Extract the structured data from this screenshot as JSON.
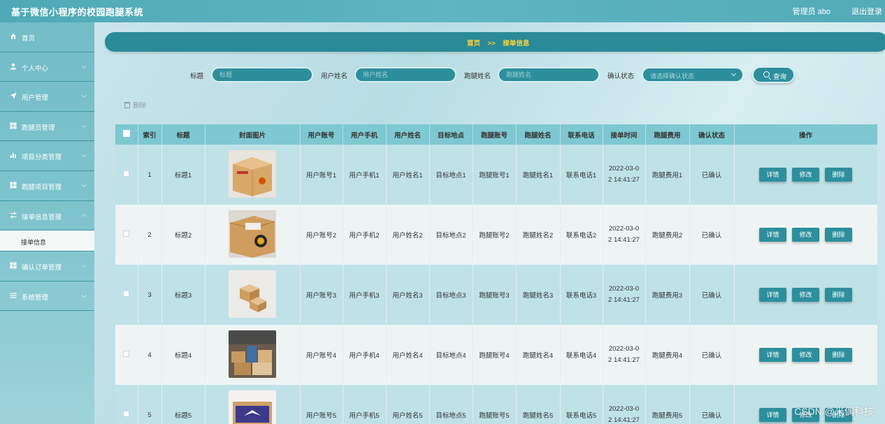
{
  "header": {
    "title": "基于微信小程序的校园跑腿系统",
    "admin": "管理员 abo",
    "logout": "退出登录"
  },
  "sidebar": {
    "items": [
      {
        "label": "首页",
        "icon": "home-icon"
      },
      {
        "label": "个人中心",
        "icon": "user-icon"
      },
      {
        "label": "用户管理",
        "icon": "send-icon"
      },
      {
        "label": "跑腿员管理",
        "icon": "grid-icon"
      },
      {
        "label": "项目分类管理",
        "icon": "bar-chart-icon"
      },
      {
        "label": "跑腿项目管理",
        "icon": "grid-icon"
      },
      {
        "label": "接单信息管理",
        "icon": "sliders-icon"
      },
      {
        "label": "确认订单管理",
        "icon": "grid-icon"
      },
      {
        "label": "系统管理",
        "icon": "list-icon"
      }
    ],
    "submenu": "接单信息"
  },
  "breadcrumb": {
    "home": "首页",
    "sep": ">>",
    "current": "接单信息"
  },
  "search": {
    "title_label": "标题",
    "title_placeholder": "标题",
    "username_label": "用户姓名",
    "username_placeholder": "用户姓名",
    "runner_label": "跑腿姓名",
    "runner_placeholder": "跑腿姓名",
    "status_label": "确认状态",
    "status_placeholder": "请选择确认状态",
    "query_btn": "查询"
  },
  "toolbar": {
    "delete": "删除"
  },
  "table": {
    "headers": [
      "索引",
      "标题",
      "封面图片",
      "用户账号",
      "用户手机",
      "用户姓名",
      "目标地点",
      "跑腿账号",
      "跑腿姓名",
      "联系电话",
      "接单时间",
      "跑腿费用",
      "确认状态",
      "操作"
    ],
    "rows": [
      {
        "idx": "1",
        "title": "标题1",
        "acct": "用户账号1",
        "phone": "用户手机1",
        "name": "用户姓名1",
        "dest": "目标地点1",
        "racct": "跑腿账号1",
        "rname": "跑腿姓名1",
        "tel": "联系电话1",
        "time1": "2022-03-0",
        "time2": "2 14:41:27",
        "fee": "跑腿费用1",
        "status": "已确认"
      },
      {
        "idx": "2",
        "title": "标题2",
        "acct": "用户账号2",
        "phone": "用户手机2",
        "name": "用户姓名2",
        "dest": "目标地点2",
        "racct": "跑腿账号2",
        "rname": "跑腿姓名2",
        "tel": "联系电话2",
        "time1": "2022-03-0",
        "time2": "2 14:41:27",
        "fee": "跑腿费用2",
        "status": "已确认"
      },
      {
        "idx": "3",
        "title": "标题3",
        "acct": "用户账号3",
        "phone": "用户手机3",
        "name": "用户姓名3",
        "dest": "目标地点3",
        "racct": "跑腿账号3",
        "rname": "跑腿姓名3",
        "tel": "联系电话3",
        "time1": "2022-03-0",
        "time2": "2 14:41:27",
        "fee": "跑腿费用3",
        "status": "已确认"
      },
      {
        "idx": "4",
        "title": "标题4",
        "acct": "用户账号4",
        "phone": "用户手机4",
        "name": "用户姓名4",
        "dest": "目标地点4",
        "racct": "跑腿账号4",
        "rname": "跑腿姓名4",
        "tel": "联系电话4",
        "time1": "2022-03-0",
        "time2": "2 14:41:27",
        "fee": "跑腿费用4",
        "status": "已确认"
      },
      {
        "idx": "5",
        "title": "标题5",
        "acct": "用户账号5",
        "phone": "用户手机5",
        "name": "用户姓名5",
        "dest": "目标地点5",
        "racct": "跑腿账号5",
        "rname": "跑腿姓名5",
        "tel": "联系电话5",
        "time1": "2022-03-0",
        "time2": "2 14:41:27",
        "fee": "跑腿费用5",
        "status": "已确认"
      }
    ],
    "ops": {
      "detail": "详情",
      "edit": "修改",
      "delete": "删除"
    }
  },
  "watermark": "CSDN @米偶科技"
}
